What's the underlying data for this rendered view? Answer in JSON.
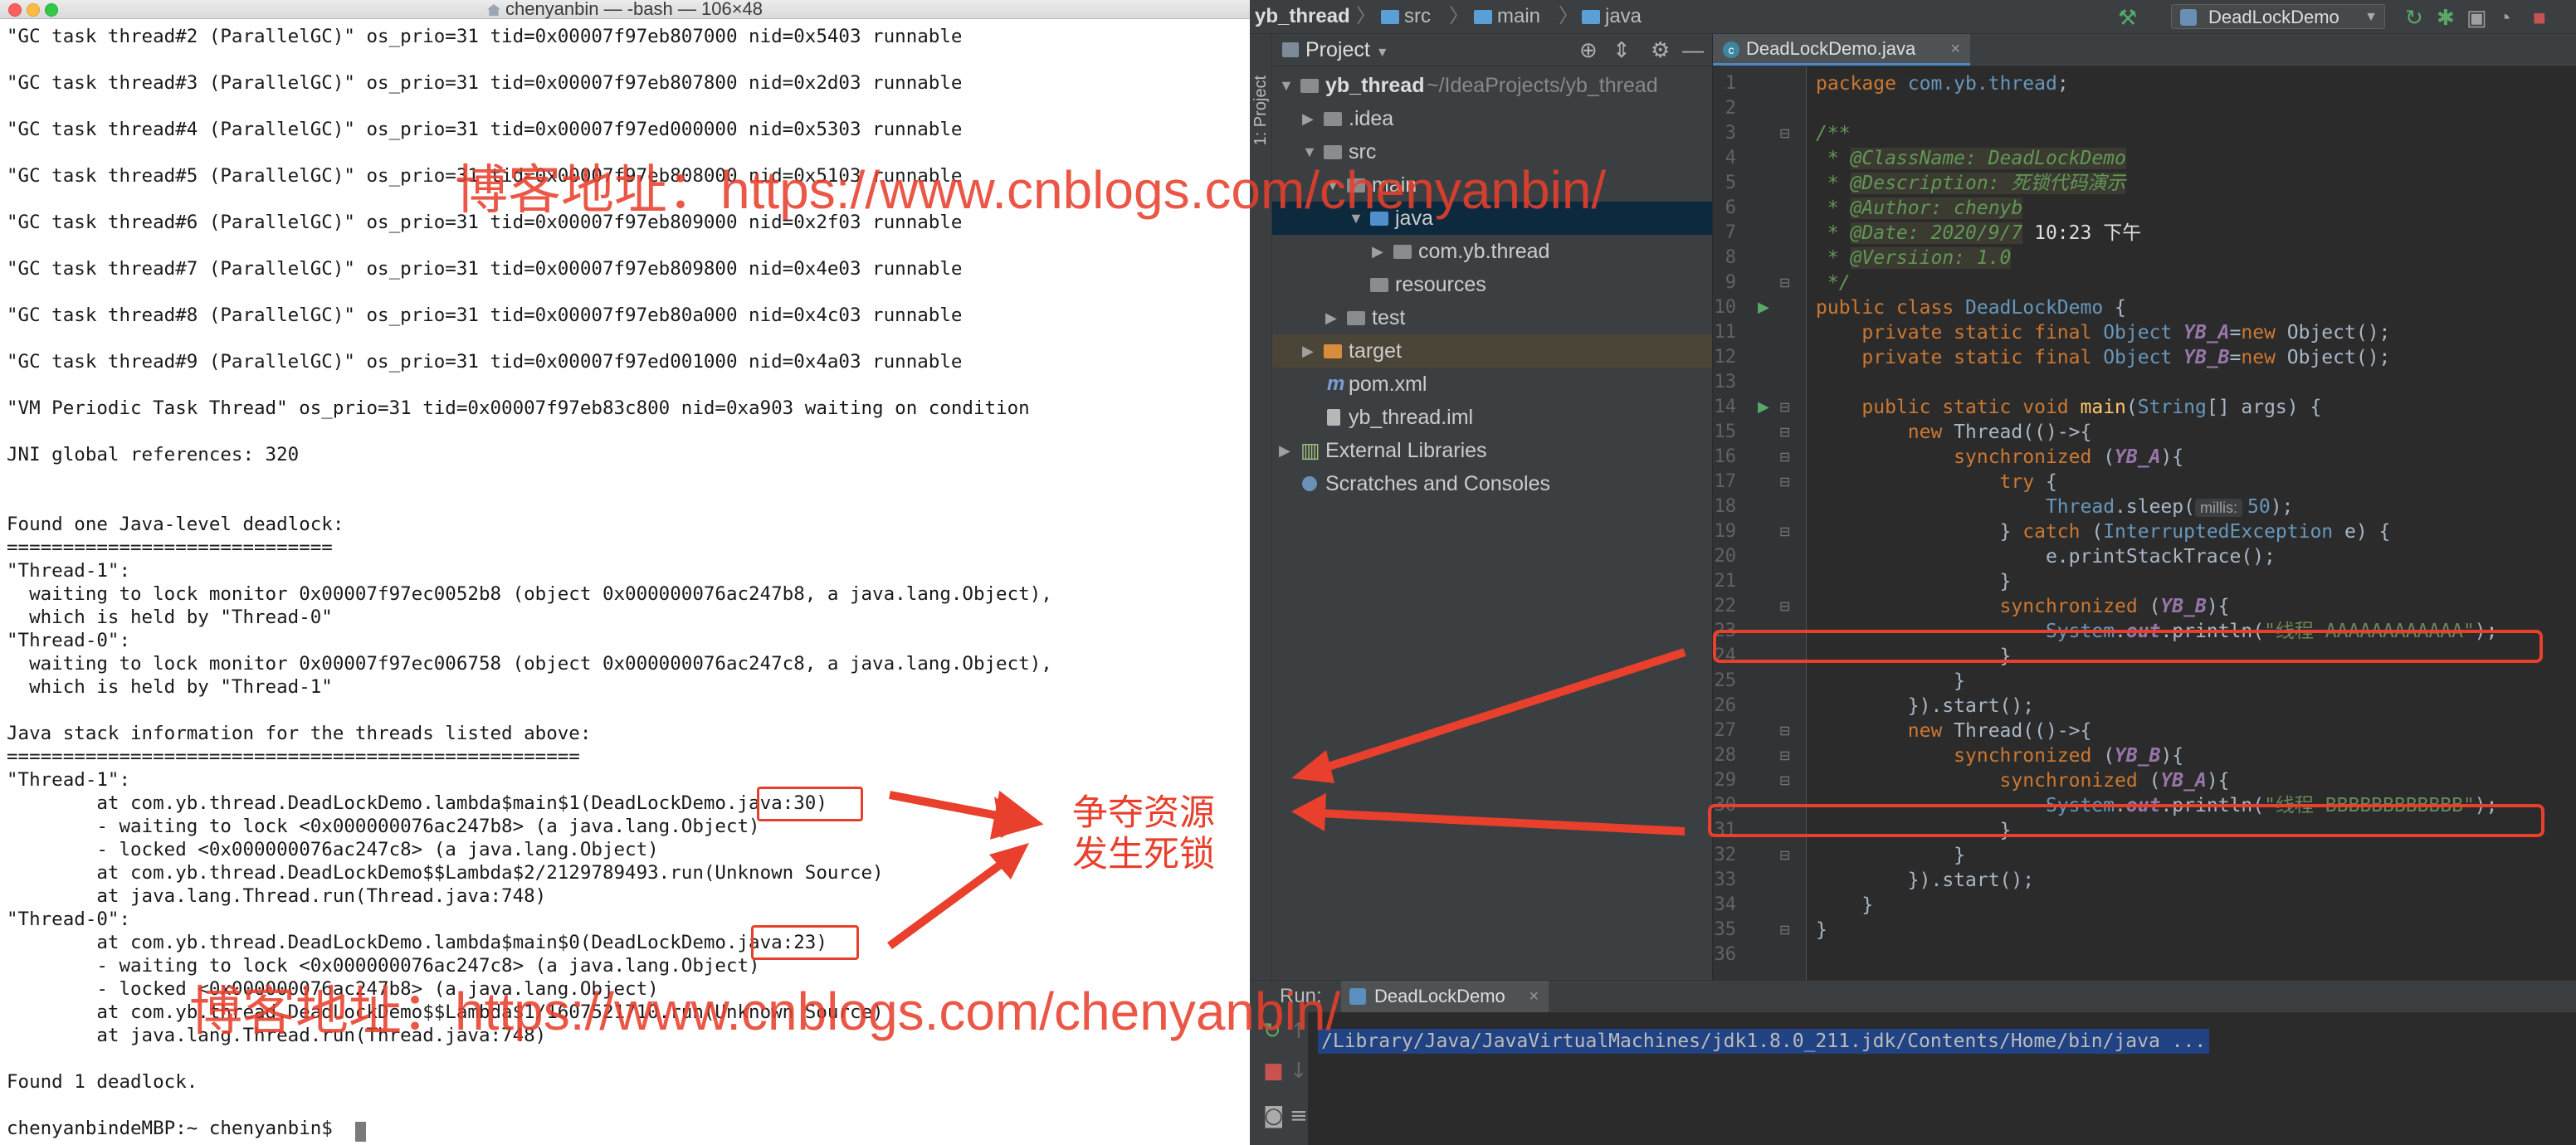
{
  "terminal": {
    "title": "chenyanbin — -bash — 106×48",
    "lines": [
      "\"GC task thread#2 (ParallelGC)\" os_prio=31 tid=0x00007f97eb807000 nid=0x5403 runnable",
      "",
      "\"GC task thread#3 (ParallelGC)\" os_prio=31 tid=0x00007f97eb807800 nid=0x2d03 runnable",
      "",
      "\"GC task thread#4 (ParallelGC)\" os_prio=31 tid=0x00007f97ed000000 nid=0x5303 runnable",
      "",
      "\"GC task thread#5 (ParallelGC)\" os_prio=31 tid=0x00007f97eb808000 nid=0x5103 runnable",
      "",
      "\"GC task thread#6 (ParallelGC)\" os_prio=31 tid=0x00007f97eb809000 nid=0x2f03 runnable",
      "",
      "\"GC task thread#7 (ParallelGC)\" os_prio=31 tid=0x00007f97eb809800 nid=0x4e03 runnable",
      "",
      "\"GC task thread#8 (ParallelGC)\" os_prio=31 tid=0x00007f97eb80a000 nid=0x4c03 runnable",
      "",
      "\"GC task thread#9 (ParallelGC)\" os_prio=31 tid=0x00007f97ed001000 nid=0x4a03 runnable",
      "",
      "\"VM Periodic Task Thread\" os_prio=31 tid=0x00007f97eb83c800 nid=0xa903 waiting on condition",
      "",
      "JNI global references: 320",
      "",
      "",
      "Found one Java-level deadlock:",
      "=============================",
      "\"Thread-1\":",
      "  waiting to lock monitor 0x00007f97ec0052b8 (object 0x000000076ac247b8, a java.lang.Object),",
      "  which is held by \"Thread-0\"",
      "\"Thread-0\":",
      "  waiting to lock monitor 0x00007f97ec006758 (object 0x000000076ac247c8, a java.lang.Object),",
      "  which is held by \"Thread-1\"",
      "",
      "Java stack information for the threads listed above:",
      "===================================================",
      "\"Thread-1\":",
      "        at com.yb.thread.DeadLockDemo.lambda$main$1(DeadLockDemo.java:30)",
      "        - waiting to lock <0x000000076ac247b8> (a java.lang.Object)",
      "        - locked <0x000000076ac247c8> (a java.lang.Object)",
      "        at com.yb.thread.DeadLockDemo$$Lambda$2/2129789493.run(Unknown Source)",
      "        at java.lang.Thread.run(Thread.java:748)",
      "\"Thread-0\":",
      "        at com.yb.thread.DeadLockDemo.lambda$main$0(DeadLockDemo.java:23)",
      "        - waiting to lock <0x000000076ac247c8> (a java.lang.Object)",
      "        - locked <0x000000076ac247b8> (a java.lang.Object)",
      "        at com.yb.thread.DeadLockDemo$$Lambda$1/1607521710.run(Unknown Source)",
      "        at java.lang.Thread.run(Thread.java:748)",
      "",
      "Found 1 deadlock.",
      "",
      "chenyanbindeMBP:~ chenyanbin$ "
    ]
  },
  "ide": {
    "breadcrumbs": [
      "yb_thread",
      "src",
      "main",
      "java"
    ],
    "run_config": "DeadLockDemo",
    "side_strip_label": "1: Project",
    "project": {
      "title": "Project",
      "tree": [
        {
          "label": "yb_thread",
          "extra": "~/IdeaProjects/yb_thread"
        },
        {
          "label": ".idea"
        },
        {
          "label": "src"
        },
        {
          "label": "main"
        },
        {
          "label": "java"
        },
        {
          "label": "com.yb.thread"
        },
        {
          "label": "resources"
        },
        {
          "label": "test"
        },
        {
          "label": "target"
        },
        {
          "label": "pom.xml"
        },
        {
          "label": "yb_thread.iml"
        },
        {
          "label": "External Libraries"
        },
        {
          "label": "Scratches and Consoles"
        }
      ]
    },
    "editor": {
      "tab_label": "DeadLockDemo.java",
      "line_numbers": [
        "1",
        "2",
        "3",
        "4",
        "5",
        "6",
        "7",
        "8",
        "9",
        "10",
        "11",
        "12",
        "13",
        "14",
        "15",
        "16",
        "17",
        "18",
        "19",
        "20",
        "21",
        "22",
        "23",
        "24",
        "25",
        "26",
        "27",
        "28",
        "29",
        "30",
        "31",
        "32",
        "33",
        "34",
        "35",
        "36"
      ],
      "code": {
        "l1_kw": "package",
        "l1_pkg": "com.yb.thread",
        "l1_end": ";",
        "l3": "/**",
        "l4_star": " * ",
        "l4_tag": "@ClassName: DeadLockDemo",
        "l5_star": " * ",
        "l5_tag": "@Description: 死锁代码演示",
        "l6_star": " * ",
        "l6_tag": "@Author: chenyb",
        "l7_star": " * ",
        "l7_tag": "@Date: 2020/9/7",
        "l7_rest": " 10:23 下午",
        "l8_star": " * ",
        "l8_tag": "@Versiion: 1.0",
        "l9": " */",
        "l10_kw": "public class ",
        "l10_name": "DeadLockDemo",
        "l10_end": " {",
        "l11_kw": "    private static final ",
        "l11_ty": "Object ",
        "l11_fld": "YB_A",
        "l11_mid": "=",
        "l11_kw2": "new ",
        "l11_end": "Object();",
        "l12_kw": "    private static final ",
        "l12_ty": "Object ",
        "l12_fld": "YB_B",
        "l12_mid": "=",
        "l12_kw2": "new ",
        "l12_end": "Object();",
        "l14_kw": "    public static void ",
        "l14_fn": "main",
        "l14_p": "(",
        "l14_ty": "String",
        "l14_end": "[] args) {",
        "l15_kw": "        new ",
        "l15_end": "Thread(()->{",
        "l16_kw": "            synchronized ",
        "l16_p": "(",
        "l16_fld": "YB_A",
        "l16_end": "){",
        "l17_kw": "                try ",
        "l17_end": "{",
        "l18_a": "                    ",
        "l18_ty": "Thread",
        "l18_b": ".sleep(",
        "l18_hint": "millis:",
        "l18_num": "50",
        "l18_end": ");",
        "l19_a": "                } ",
        "l19_kw": "catch ",
        "l19_p": "(",
        "l19_ty": "InterruptedException",
        "l19_end": " e) {",
        "l20": "                    e.printStackTrace();",
        "l21": "                }",
        "l22_kw": "                synchronized ",
        "l22_p": "(",
        "l22_fld": "YB_B",
        "l22_end": "){",
        "l23_a": "                    ",
        "l23_ty": "System",
        "l23_dot": ".",
        "l23_fld": "out",
        "l23_b": ".println(",
        "l23_str": "\"线程-AAAAAAAAAAAA\"",
        "l23_end": ");",
        "l24": "                }",
        "l25": "            }",
        "l26": "        }).start();",
        "l27_kw": "        new ",
        "l27_end": "Thread(()->{",
        "l28_kw": "            synchronized ",
        "l28_p": "(",
        "l28_fld": "YB_B",
        "l28_end": "){",
        "l29_kw": "                synchronized ",
        "l29_p": "(",
        "l29_fld": "YB_A",
        "l29_end": "){",
        "l30_a": "                    ",
        "l30_ty": "System",
        "l30_dot": ".",
        "l30_fld": "out",
        "l30_b": ".println(",
        "l30_str": "\"线程-BBBBBBBBBBBB\"",
        "l30_end": ");",
        "l31": "                }",
        "l32": "            }",
        "l33": "        }).start();",
        "l34": "    }",
        "l35": "}"
      }
    },
    "run_panel": {
      "label": "Run:",
      "tab_label": "DeadLockDemo",
      "console_line": "/Library/Java/JavaVirtualMachines/jdk1.8.0_211.jdk/Contents/Home/bin/java ..."
    }
  },
  "annotations": {
    "watermark_text": "博客地址：https://www.cnblogs.com/chenyanbin/",
    "callout": [
      "争夺资源",
      "发生死锁"
    ],
    "color": "#e8402c"
  }
}
